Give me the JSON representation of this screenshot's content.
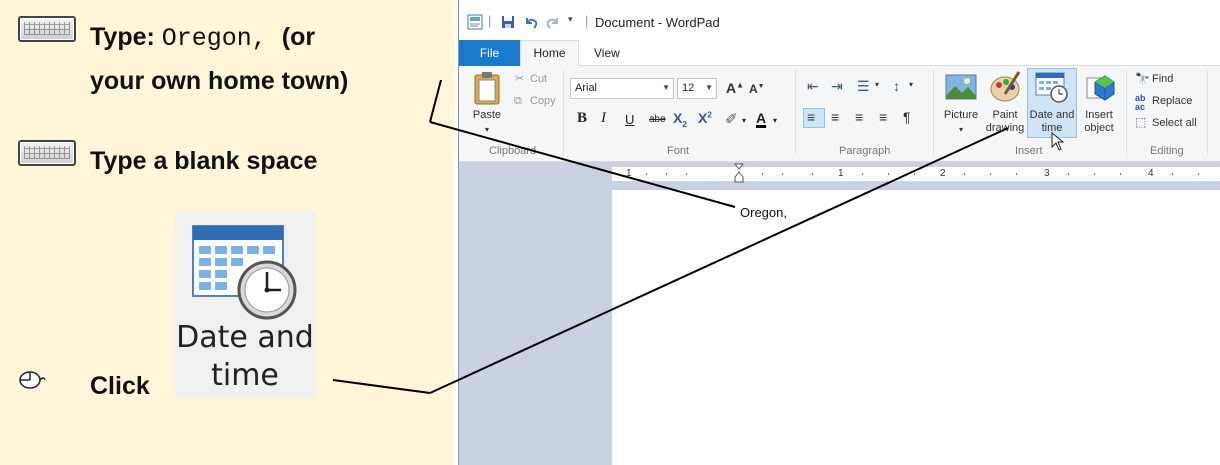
{
  "instructions": {
    "step1": {
      "prefix": "Type:",
      "typed": "Oregon,",
      "suffix": "(or",
      "line2": "your own home town)"
    },
    "step2": {
      "text": "Type a blank space"
    },
    "step3": {
      "action": "Click",
      "button_label_line1": "Date and",
      "button_label_line2": "time"
    },
    "icons": {
      "keyboard": "keyboard-icon",
      "mouse": "mouse-icon",
      "calendar_clock": "calendar-clock-icon"
    }
  },
  "window": {
    "title": "Document - WordPad",
    "tabs": {
      "file": "File",
      "home": "Home",
      "view": "View"
    },
    "ribbon": {
      "clipboard": {
        "label": "Clipboard",
        "paste": "Paste",
        "cut": "Cut",
        "copy": "Copy"
      },
      "font": {
        "label": "Font",
        "font_name": "Arial",
        "font_size": "12"
      },
      "paragraph": {
        "label": "Paragraph"
      },
      "insert": {
        "label": "Insert",
        "picture": "Picture",
        "paint_line1": "Paint",
        "paint_line2": "drawing",
        "datetime_line1": "Date and",
        "datetime_line2": "time",
        "object_line1": "Insert",
        "object_line2": "object"
      },
      "editing": {
        "label": "Editing",
        "find": "Find",
        "replace": "Replace",
        "select_all": "Select all"
      }
    },
    "ruler": {
      "numbers": [
        "1",
        "1",
        "2",
        "3",
        "4"
      ]
    },
    "document": {
      "text": "Oregon,"
    }
  },
  "colors": {
    "panel_bg": "#fff5d9",
    "file_tab": "#1979ca",
    "ribbon_bg": "#f5f6f7",
    "doc_bg": "#c9d2e3"
  }
}
